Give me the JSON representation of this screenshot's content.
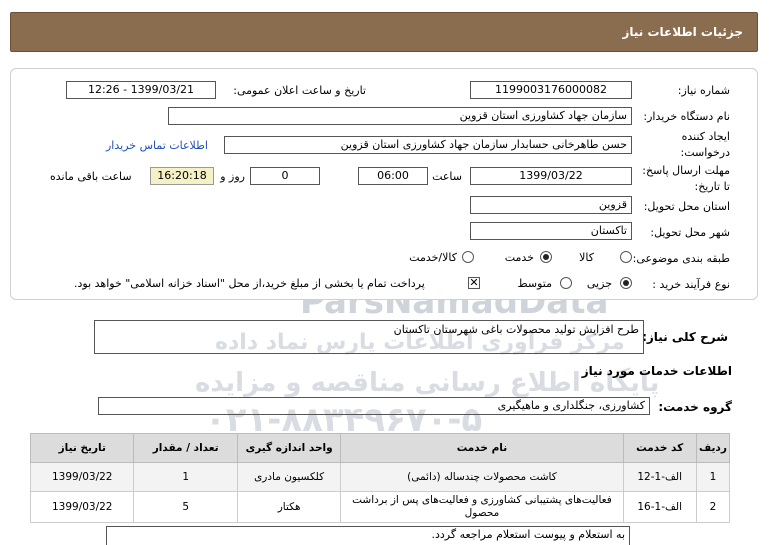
{
  "header": {
    "title": "جزئیات اطلاعات نیاز"
  },
  "form": {
    "need_number_label": "شماره نیاز:",
    "need_number": "1199003176000082",
    "announce_label": "تاریخ و ساعت اعلان عمومی:",
    "announce_value": "1399/03/21 - 12:26",
    "buyer_label": "نام دستگاه خریدار:",
    "buyer_value": "سازمان جهاد کشاورزی استان قزوین",
    "requester_label_1": "ایجاد کننده",
    "requester_label_2": "درخواست:",
    "requester_value": "حسن طاهرخانی حسابدار سازمان جهاد کشاورزی استان قزوین",
    "contact_link": "اطلاعات تماس خریدار",
    "deadline_label_1": "مهلت ارسال پاسخ:",
    "deadline_label_2": "تا تاریخ:",
    "deadline_date": "1399/03/22",
    "time_label": "ساعت",
    "deadline_time": "06:00",
    "days_value": "0",
    "days_label": "روز و",
    "remaining_time": "16:20:18",
    "remaining_label": "ساعت باقی مانده",
    "province_label": "استان محل تحویل:",
    "province_value": "قزوین",
    "city_label": "شهر محل تحویل:",
    "city_value": "تاکستان",
    "category_label": "طبقه بندی موضوعی:",
    "category_options": [
      "کالا",
      "خدمت",
      "کالا/خدمت"
    ],
    "category_selected": "خدمت",
    "process_label": "نوع فرآیند خرید :",
    "process_options": [
      "جزیی",
      "متوسط"
    ],
    "process_selected": "جزیی",
    "payment_note": "پرداخت تمام یا بخشی از مبلغ خرید،از محل \"اسناد خزانه اسلامی\" خواهد بود."
  },
  "summary": {
    "label": "شرح کلی نیاز:",
    "value": "طرح افزایش تولید محصولات باغی شهرستان تاکستان"
  },
  "services": {
    "section_title": "اطلاعات خدمات مورد نیاز",
    "group_label": "گروه خدمت:",
    "group_value": "کشاورزی، جنگلداری و ماهیگیری",
    "columns": [
      "ردیف",
      "کد خدمت",
      "نام خدمت",
      "واحد اندازه گیری",
      "تعداد / مقدار",
      "تاریخ نیاز"
    ],
    "rows": [
      {
        "idx": "1",
        "code": "الف-1-12",
        "name": "کاشت محصولات چندساله (دائمی)",
        "unit": "کلکسیون مادری",
        "qty": "1",
        "date": "1399/03/22"
      },
      {
        "idx": "2",
        "code": "الف-1-16",
        "name": "فعالیت‌های پشتیبانی کشاورزی و فعالیت‌های پس از برداشت محصول",
        "unit": "هکتار",
        "qty": "5",
        "date": "1399/03/22"
      }
    ]
  },
  "notes": {
    "value": "به استعلام و پیوست استعلام مراجعه گردد."
  },
  "watermark": {
    "brand": "ParsNamadData",
    "line1": "مرکز فراوری اطلاعات پارس نماد داده",
    "line2": "پایگاه اطلاع رسانی مناقصه و مزایده",
    "phone": "۰۲۱-۸۸۳۴۹۶۷۰-۵"
  }
}
